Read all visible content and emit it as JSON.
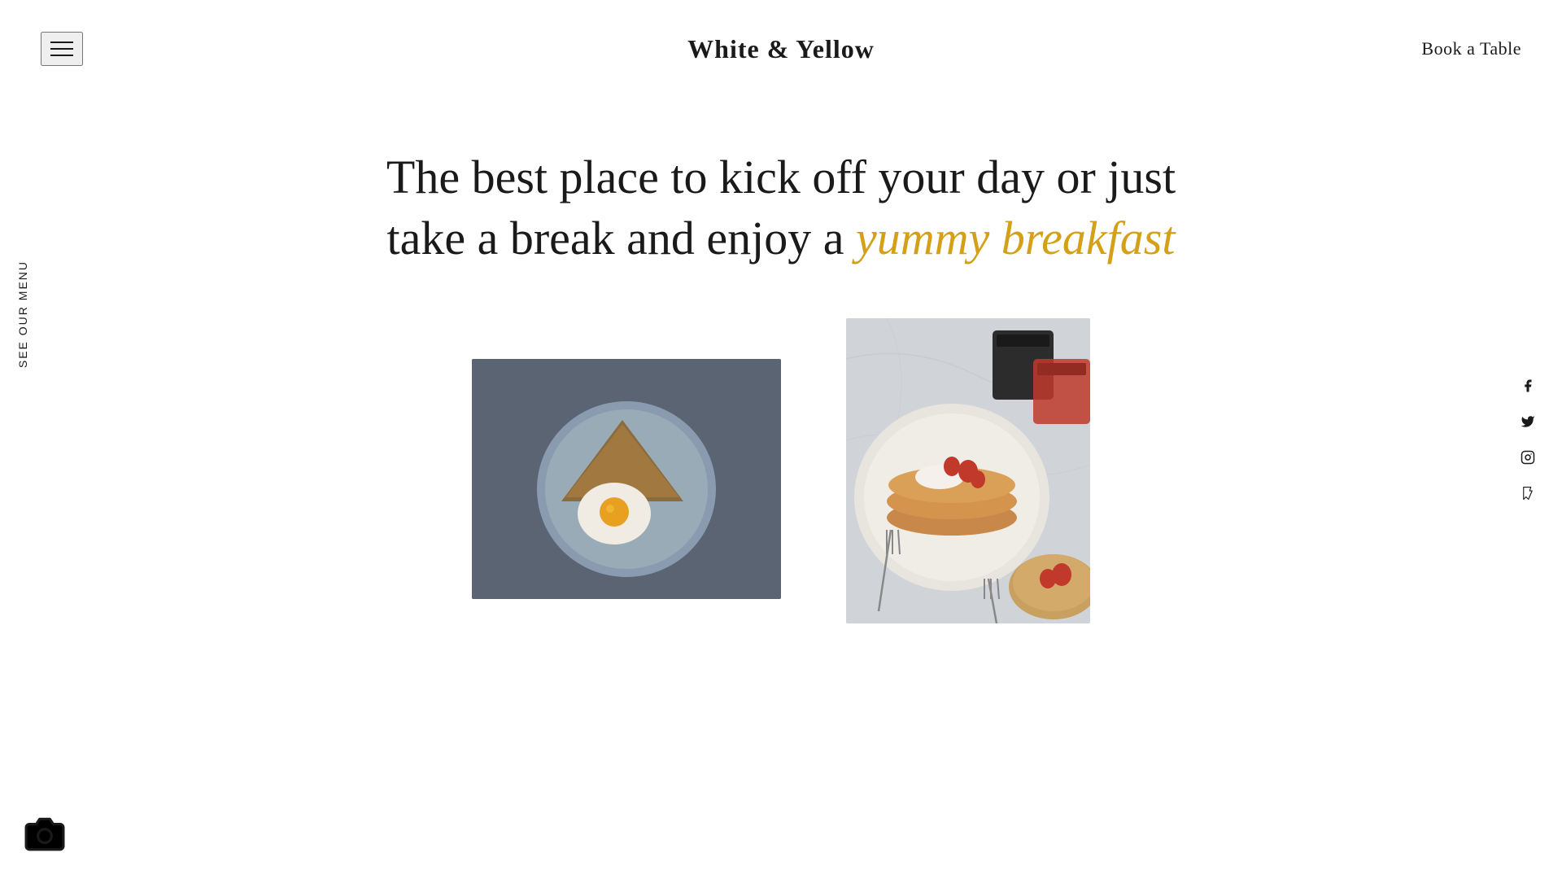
{
  "header": {
    "site_title": "White & Yellow",
    "book_table_label": "Book a Table"
  },
  "left_sidebar": {
    "menu_label": "See Our Menu"
  },
  "hero": {
    "line1": "The best place to kick off your day or just",
    "line2_plain": "take a break and enjoy a ",
    "line2_highlight": "yummy breakfast"
  },
  "social": {
    "facebook_icon": "f",
    "twitter_icon": "t",
    "instagram_icon": "i",
    "foursquare_icon": "4"
  },
  "images": {
    "image1_alt": "Fried egg and toast on a plate",
    "image2_alt": "Pancakes with strawberries and coffee"
  },
  "colors": {
    "accent": "#d4a017",
    "dark": "#1a1a1a",
    "bg": "#ffffff"
  }
}
